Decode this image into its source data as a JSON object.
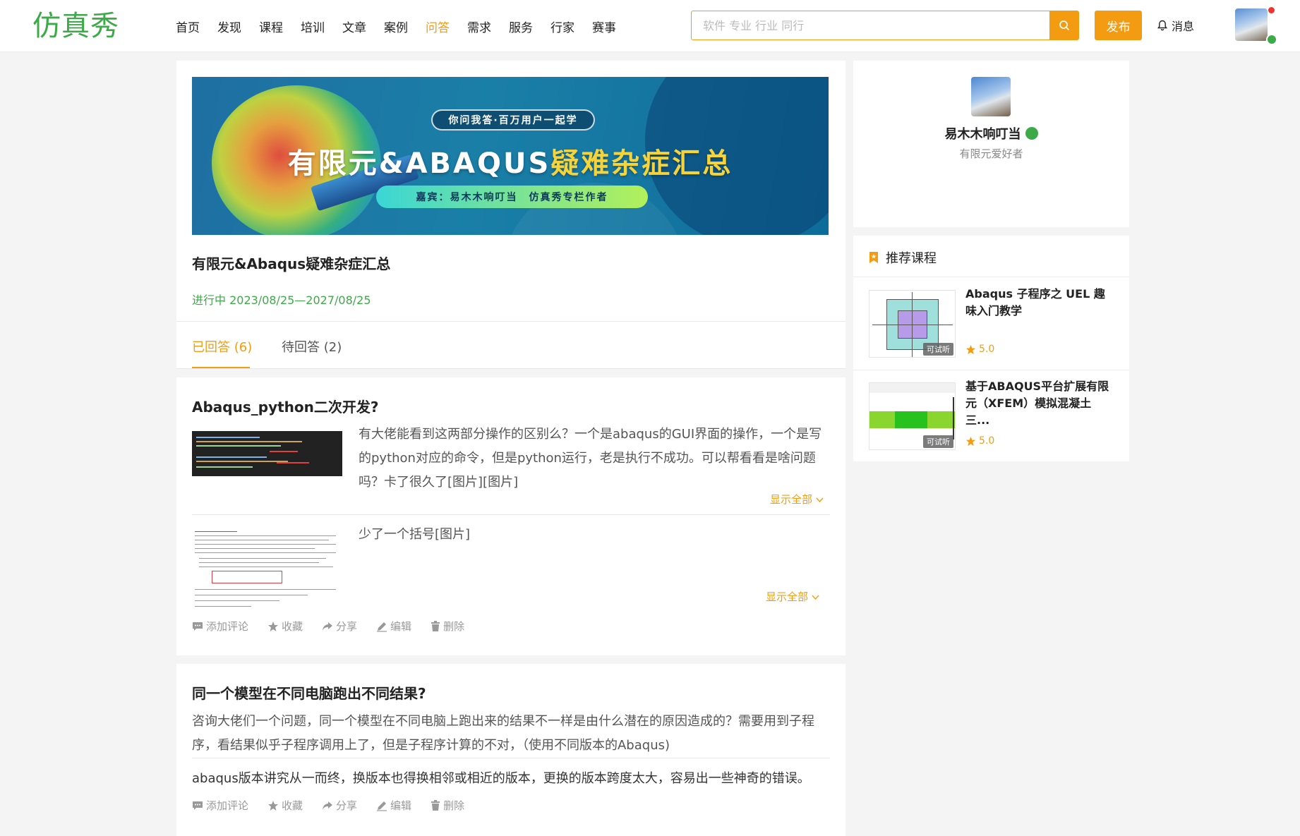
{
  "header": {
    "logo": "仿真秀",
    "nav": [
      "首页",
      "发现",
      "课程",
      "培训",
      "文章",
      "案例",
      "问答",
      "需求",
      "服务",
      "行家",
      "赛事"
    ],
    "active_nav": "问答",
    "search_placeholder": "软件 专业 行业 同行",
    "publish_label": "发布",
    "messages_label": "消息"
  },
  "topic": {
    "banner": {
      "tagline": "你问我答·百万用户一起学",
      "title_white": "有限元&ABAQUS",
      "title_yellow": "疑难杂症汇总",
      "guest": "嘉宾：易木木响叮当　仿真秀专栏作者"
    },
    "title": "有限元&Abaqus疑难杂症汇总",
    "status": "进行中  2023/08/25—2027/08/25",
    "tabs": [
      {
        "label": "已回答 (6)",
        "active": true
      },
      {
        "label": "待回答 (2)",
        "active": false
      }
    ]
  },
  "questions": [
    {
      "title": "Abaqus_python二次开发?",
      "answers": [
        {
          "text": "有大佬能看到这两部分操作的区别么？一个是abaqus的GUI界面的操作，一个是写的python对应的命令，但是python运行，老是执行不成功。可以帮看看是啥问题吗？卡了很久了[图片][图片]",
          "show_all": "显示全部"
        },
        {
          "text": "少了一个括号[图片]",
          "show_all": "显示全部"
        }
      ],
      "actions": [
        "添加评论",
        "收藏",
        "分享",
        "编辑",
        "删除"
      ]
    },
    {
      "title": "同一个模型在不同电脑跑出不同结果?",
      "text": "咨询大佬们一个问题，同一个模型在不同电脑上跑出来的结果不一样是由什么潜在的原因造成的？需要用到子程序，看结果似乎子程序调用上了，但是子程序计算的不对，（使用不同版本的Abaqus)",
      "answer": "abaqus版本讲究从一而终，换版本也得换相邻或相近的版本，更换的版本跨度太大，容易出一些神奇的错误。",
      "actions": [
        "添加评论",
        "收藏",
        "分享",
        "编辑",
        "删除"
      ]
    }
  ],
  "profile": {
    "name": "易木木响叮当",
    "desc": "有限元爱好者"
  },
  "courses": {
    "heading": "推荐课程",
    "items": [
      {
        "title": "Abaqus 子程序之 UEL 趣味入门教学",
        "trial": "可试听",
        "rating": "5.0"
      },
      {
        "title": "基于ABAQUS平台扩展有限元（XFEM）模拟混凝土三...",
        "trial": "可试听",
        "rating": "5.0"
      }
    ]
  },
  "colors": {
    "accent": "#f39c12",
    "brand_green": "#3daa48"
  }
}
